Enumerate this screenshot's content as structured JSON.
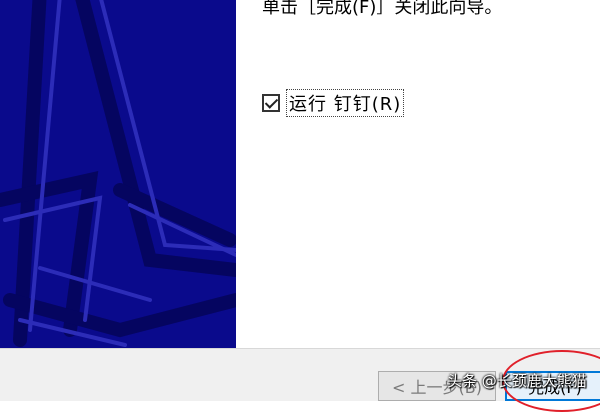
{
  "wizard": {
    "instruction": "单击［完成(F)］关闭此向导。",
    "run_option_label": "运行 钉钉(R)",
    "run_option_checked": true
  },
  "buttons": {
    "back_label": "< 上一步(B)",
    "finish_label": "完成(F)"
  },
  "watermark": "头条 @长颈鹿大熊猫",
  "colors": {
    "side_panel": "#0a0a8c",
    "annotation_circle": "#e0202a"
  }
}
